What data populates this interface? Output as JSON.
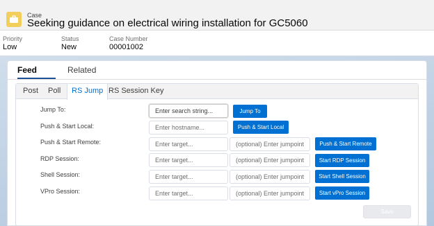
{
  "record": {
    "object_label": "Case",
    "title": "Seeking guidance on electrical wiring installation for GC5060",
    "fields": [
      {
        "label": "Priority",
        "value": "Low"
      },
      {
        "label": "Status",
        "value": "New"
      },
      {
        "label": "Case Number",
        "value": "00001002"
      }
    ]
  },
  "tabs": [
    {
      "label": "Feed",
      "active": true
    },
    {
      "label": "Related",
      "active": false
    }
  ],
  "subtabs": [
    {
      "label": "Post"
    },
    {
      "label": "Poll"
    },
    {
      "label": "RS Jump",
      "active": true
    },
    {
      "label": "RS Session Key"
    }
  ],
  "rs_jump": {
    "jump_to": {
      "label": "Jump To:",
      "placeholder": "Enter search string...",
      "button": "Jump To"
    },
    "push_local": {
      "label": "Push & Start Local:",
      "placeholder": "Enter hostname...",
      "button": "Push & Start Local"
    },
    "push_remote": {
      "label": "Push & Start Remote:",
      "target_placeholder": "Enter target...",
      "jumpoint_placeholder": "(optional) Enter jumpoint...",
      "button": "Push & Start Remote"
    },
    "rdp": {
      "label": "RDP Session:",
      "target_placeholder": "Enter target...",
      "jumpoint_placeholder": "(optional) Enter jumpoint...",
      "button": "Start RDP Session"
    },
    "shell": {
      "label": "Shell Session:",
      "target_placeholder": "Enter target...",
      "jumpoint_placeholder": "(optional) Enter jumpoint...",
      "button": "Start Shell Session"
    },
    "vpro": {
      "label": "VPro Session:",
      "target_placeholder": "Enter target...",
      "jumpoint_placeholder": "(optional) Enter jumpoint...",
      "button": "Start vPro Session"
    },
    "save_label": "Save"
  },
  "colors": {
    "brand": "#0070d2",
    "case_icon": "#f2cf5b",
    "active_tab_underline": "#1b5297"
  }
}
